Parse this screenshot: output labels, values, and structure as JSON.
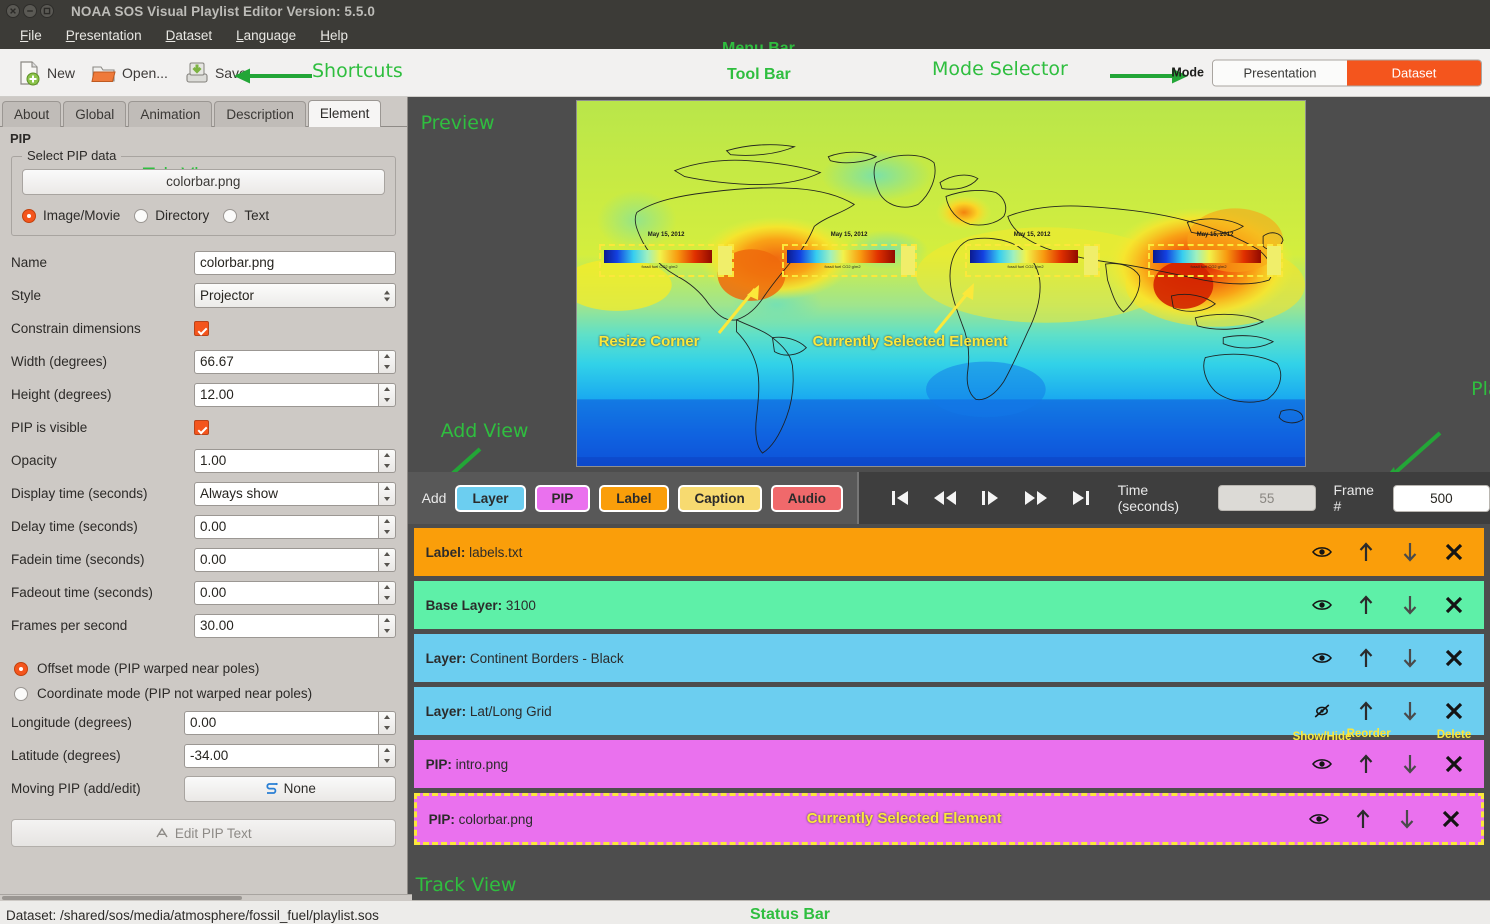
{
  "window": {
    "title": "NOAA SOS Visual Playlist Editor Version: 5.5.0",
    "close_icon": "close-icon",
    "minimize_icon": "minimize-icon",
    "maximize_icon": "maximize-icon"
  },
  "annotations": {
    "menu_bar": "Menu Bar",
    "tool_bar": "Tool Bar",
    "shortcuts": "Shortcuts",
    "mode_selector": "Mode Selector",
    "tab_view": "Tab View",
    "preview": "Preview",
    "add_view": "Add View",
    "playback_view": "Playback\nView",
    "track_view": "Track View",
    "status_bar": "Status Bar",
    "resize_corner": "Resize Corner",
    "selected_element_preview": "Currently Selected Element",
    "selected_element_track": "Currently Selected Element",
    "show_hide": "Show/Hide",
    "reorder": "Reorder",
    "delete": "Delete",
    "green": "#2fbe3f",
    "yellow": "#fbe83b"
  },
  "menu": {
    "items": [
      {
        "label": "File",
        "accel": "F"
      },
      {
        "label": "Presentation",
        "accel": "P"
      },
      {
        "label": "Dataset",
        "accel": "D"
      },
      {
        "label": "Language",
        "accel": "L"
      },
      {
        "label": "Help",
        "accel": "H"
      }
    ]
  },
  "toolbar": {
    "new_label": "New",
    "open_label": "Open...",
    "save_label": "Save",
    "new_icon": "new-document-icon",
    "open_icon": "open-folder-icon",
    "save_icon": "save-disk-icon"
  },
  "mode": {
    "label": "Mode",
    "options": [
      "Presentation",
      "Dataset"
    ],
    "selected": "Dataset",
    "accent": "#f4551d"
  },
  "tabs": {
    "items": [
      "About",
      "Global",
      "Animation",
      "Description",
      "Element"
    ],
    "active": "Element"
  },
  "panel": {
    "section_title": "PIP",
    "group_label": "Select PIP data",
    "file_button": "colorbar.png",
    "source_options": [
      "Image/Movie",
      "Directory",
      "Text"
    ],
    "source_selected": "Image/Movie",
    "fields": [
      {
        "label": "Name",
        "value": "colorbar.png",
        "kind": "text"
      },
      {
        "label": "Style",
        "value": "Projector",
        "kind": "combo"
      },
      {
        "label": "Constrain dimensions",
        "value": "checked",
        "kind": "check"
      },
      {
        "label": "Width (degrees)",
        "value": "66.67",
        "kind": "spin"
      },
      {
        "label": "Height (degrees)",
        "value": "12.00",
        "kind": "spin"
      },
      {
        "label": "PIP is visible",
        "value": "checked",
        "kind": "check"
      },
      {
        "label": "Opacity",
        "value": "1.00",
        "kind": "spin"
      },
      {
        "label": "Display time (seconds)",
        "value": "Always show",
        "kind": "spin"
      },
      {
        "label": "Delay time (seconds)",
        "value": "0.00",
        "kind": "spin"
      },
      {
        "label": "Fadein time (seconds)",
        "value": "0.00",
        "kind": "spin"
      },
      {
        "label": "Fadeout time (seconds)",
        "value": "0.00",
        "kind": "spin"
      },
      {
        "label": "Frames per second",
        "value": "30.00",
        "kind": "spin"
      }
    ],
    "mode_options": [
      "Offset mode (PIP warped near poles)",
      "Coordinate mode (PIP not warped near poles)"
    ],
    "mode_selected": "Offset mode (PIP warped near poles)",
    "coord_fields": [
      {
        "label": "Longitude (degrees)",
        "value": "0.00"
      },
      {
        "label": "Latitude (degrees)",
        "value": "-34.00"
      }
    ],
    "moving_pip_label": "Moving PIP (add/edit)",
    "moving_pip_value": "None",
    "moving_pip_icon": "path-icon",
    "edit_pip_text": "Edit PIP Text",
    "edit_pip_icon": "letter-a-icon"
  },
  "preview": {
    "pip_date_label": "May 15, 2012",
    "pip_scale_label": "fossil fuel CO2  g/m2",
    "pip_count": 4
  },
  "add": {
    "label": "Add",
    "buttons": [
      {
        "label": "Layer",
        "color": "#6ccef0"
      },
      {
        "label": "PIP",
        "color": "#ea71ee"
      },
      {
        "label": "Label",
        "color": "#fa9e0a"
      },
      {
        "label": "Caption",
        "color": "#f7da70"
      },
      {
        "label": "Audio",
        "color": "#f0696b"
      }
    ]
  },
  "playback": {
    "buttons": [
      {
        "name": "skip-to-start-icon"
      },
      {
        "name": "rewind-icon"
      },
      {
        "name": "step-forward-icon"
      },
      {
        "name": "fast-forward-icon"
      },
      {
        "name": "skip-to-end-icon"
      }
    ],
    "time_label": "Time (seconds)",
    "time_value": "55",
    "frame_label": "Frame #",
    "frame_value": "500"
  },
  "tracks": [
    {
      "type": "Label",
      "name": "labels.txt",
      "color": "#fa9e0a",
      "visible": true,
      "selected": false,
      "show_anno": false
    },
    {
      "type": "Base Layer",
      "name": "3100",
      "color": "#5ef0a8",
      "visible": true,
      "selected": false,
      "show_anno": false
    },
    {
      "type": "Layer",
      "name": "Continent Borders - Black",
      "color": "#6ccef0",
      "visible": true,
      "selected": false,
      "show_anno": false
    },
    {
      "type": "Layer",
      "name": "Lat/Long Grid",
      "color": "#6ccef0",
      "visible": false,
      "selected": false,
      "show_anno": true
    },
    {
      "type": "PIP",
      "name": "intro.png",
      "color": "#ea71ee",
      "visible": true,
      "selected": false,
      "show_anno": false
    },
    {
      "type": "PIP",
      "name": "colorbar.png",
      "color": "#ea71ee",
      "visible": true,
      "selected": true,
      "show_anno": false
    }
  ],
  "track_icons": {
    "eye": "eye-icon",
    "eye_off": "eye-off-icon",
    "up": "arrow-up-icon",
    "down": "arrow-down-icon",
    "close": "x-icon"
  },
  "status": {
    "text": "Dataset:  /shared/sos/media/atmosphere/fossil_fuel/playlist.sos"
  }
}
